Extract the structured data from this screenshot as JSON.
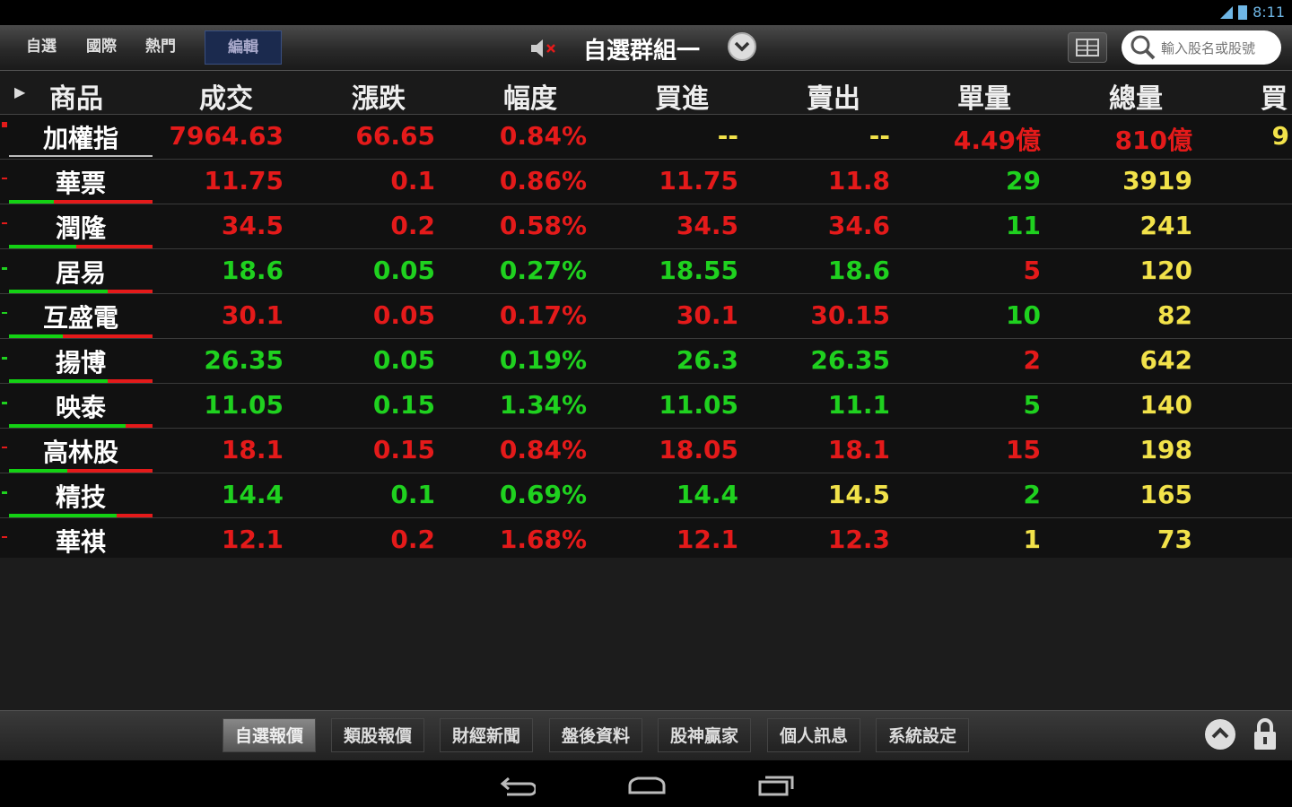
{
  "status_bar": {
    "time": "8:11",
    "wifi_icon": "wifi-icon",
    "battery_icon": "battery-icon"
  },
  "top_tabs": [
    {
      "label": "自選"
    },
    {
      "label": "國際"
    },
    {
      "label": "熱門"
    },
    {
      "label": "編輯"
    }
  ],
  "group": {
    "title": "自選群組一"
  },
  "search": {
    "placeholder": "輸入股名或股號"
  },
  "columns": [
    "商品",
    "成交",
    "漲跌",
    "幅度",
    "買進",
    "賣出",
    "單量",
    "總量",
    "買"
  ],
  "rows": [
    {
      "name": "加權指",
      "price": "7964.63",
      "change": "66.65",
      "pct": "0.84%",
      "bid": "--",
      "ask": "--",
      "vol": "4.49億",
      "total": "810億",
      "extra": "9",
      "dir": "up"
    },
    {
      "name": "華票",
      "price": "11.75",
      "change": "0.1",
      "pct": "0.86%",
      "bid": "11.75",
      "ask": "11.8",
      "vol": "29",
      "total": "3919",
      "extra": "",
      "dir": "up"
    },
    {
      "name": "潤隆",
      "price": "34.5",
      "change": "0.2",
      "pct": "0.58%",
      "bid": "34.5",
      "ask": "34.6",
      "vol": "11",
      "total": "241",
      "extra": "",
      "dir": "up"
    },
    {
      "name": "居易",
      "price": "18.6",
      "change": "0.05",
      "pct": "0.27%",
      "bid": "18.55",
      "ask": "18.6",
      "vol": "5",
      "total": "120",
      "extra": "",
      "dir": "down"
    },
    {
      "name": "互盛電",
      "price": "30.1",
      "change": "0.05",
      "pct": "0.17%",
      "bid": "30.1",
      "ask": "30.15",
      "vol": "10",
      "total": "82",
      "extra": "",
      "dir": "up"
    },
    {
      "name": "揚博",
      "price": "26.35",
      "change": "0.05",
      "pct": "0.19%",
      "bid": "26.3",
      "ask": "26.35",
      "vol": "2",
      "total": "642",
      "extra": "",
      "dir": "down"
    },
    {
      "name": "映泰",
      "price": "11.05",
      "change": "0.15",
      "pct": "1.34%",
      "bid": "11.05",
      "ask": "11.1",
      "vol": "5",
      "total": "140",
      "extra": "",
      "dir": "down"
    },
    {
      "name": "高林股",
      "price": "18.1",
      "change": "0.15",
      "pct": "0.84%",
      "bid": "18.05",
      "ask": "18.1",
      "vol": "15",
      "total": "198",
      "extra": "",
      "dir": "up"
    },
    {
      "name": "精技",
      "price": "14.4",
      "change": "0.1",
      "pct": "0.69%",
      "bid": "14.4",
      "ask": "14.5",
      "vol": "2",
      "total": "165",
      "extra": "",
      "dir": "down"
    },
    {
      "name": "華祺",
      "price": "12.1",
      "change": "0.2",
      "pct": "1.68%",
      "bid": "12.1",
      "ask": "12.3",
      "vol": "1",
      "total": "73",
      "extra": "",
      "dir": "up"
    }
  ],
  "bottom_tabs": [
    {
      "label": "自選報價"
    },
    {
      "label": "類股報價"
    },
    {
      "label": "財經新聞"
    },
    {
      "label": "盤後資料"
    },
    {
      "label": "股神贏家"
    },
    {
      "label": "個人訊息"
    },
    {
      "label": "系統設定"
    }
  ],
  "colors": {
    "up": "#e41a1a",
    "down": "#1fd11f",
    "volume_total": "#f2e24a",
    "bid_ask_neutral_up": "#e41a1a"
  }
}
